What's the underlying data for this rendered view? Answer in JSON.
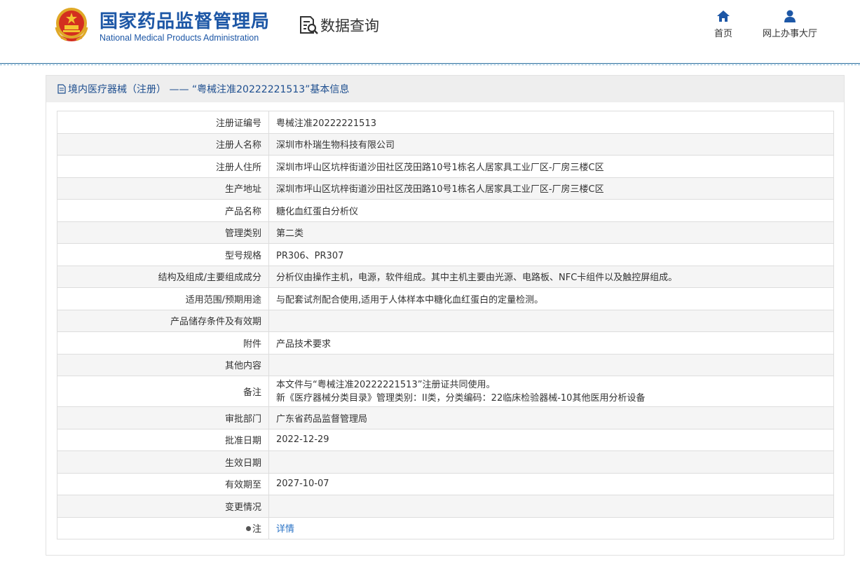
{
  "header": {
    "title": "国家药品监督管理局",
    "subtitle": "National Medical Products Administration",
    "query_label": "数据查询",
    "nav": [
      {
        "label": "首页",
        "icon": "home-icon"
      },
      {
        "label": "网上办事大厅",
        "icon": "user-icon"
      }
    ]
  },
  "panel": {
    "title": "境内医疗器械（注册） —— “粤械注准20222221513”基本信息"
  },
  "rows": [
    {
      "key": "注册证编号",
      "value": "粤械注准20222221513"
    },
    {
      "key": "注册人名称",
      "value": "深圳市朴瑞生物科技有限公司"
    },
    {
      "key": "注册人住所",
      "value": "深圳市坪山区坑梓街道沙田社区茂田路10号1栋名人居家具工业厂区-厂房三楼C区"
    },
    {
      "key": "生产地址",
      "value": "深圳市坪山区坑梓街道沙田社区茂田路10号1栋名人居家具工业厂区-厂房三楼C区"
    },
    {
      "key": "产品名称",
      "value": "糖化血红蛋白分析仪"
    },
    {
      "key": "管理类别",
      "value": "第二类"
    },
    {
      "key": "型号规格",
      "value": "PR306、PR307"
    },
    {
      "key": "结构及组成/主要组成成分",
      "value": "分析仪由操作主机，电源，软件组成。其中主机主要由光源、电路板、NFC卡组件以及触控屏组成。"
    },
    {
      "key": "适用范围/预期用途",
      "value": "与配套试剂配合使用,适用于人体样本中糖化血红蛋白的定量检测。"
    },
    {
      "key": "产品储存条件及有效期",
      "value": ""
    },
    {
      "key": "附件",
      "value": "产品技术要求"
    },
    {
      "key": "其他内容",
      "value": ""
    },
    {
      "key": "备注",
      "value_line1": "本文件与“粤械注准20222221513”注册证共同使用。",
      "value_line2": "新《医疗器械分类目录》管理类别：II类，分类编码：22临床检验器械-10其他医用分析设备"
    },
    {
      "key": "审批部门",
      "value": "广东省药品监督管理局"
    },
    {
      "key": "批准日期",
      "value": "2022-12-29"
    },
    {
      "key": "生效日期",
      "value": ""
    },
    {
      "key": "有效期至",
      "value": "2027-10-07"
    },
    {
      "key": "变更情况",
      "value": ""
    },
    {
      "key": "注",
      "value": "详情"
    }
  ]
}
